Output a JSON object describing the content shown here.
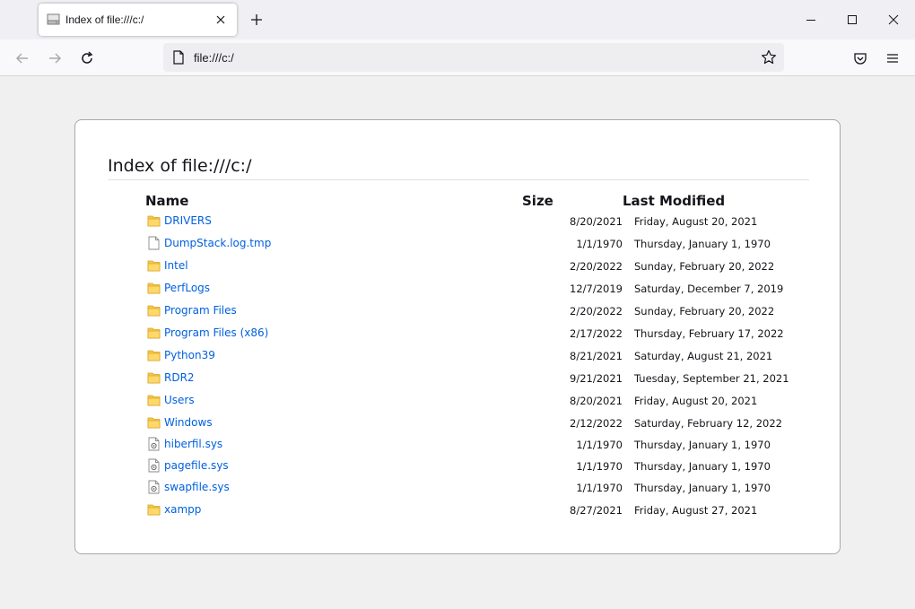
{
  "browser": {
    "tab_title": "Index of file:///c:/",
    "url": "file:///c:/",
    "icons": {
      "favicon": "drive-icon",
      "close": "close-icon",
      "new_tab": "plus-icon",
      "back": "back-arrow-icon",
      "forward": "forward-arrow-icon",
      "reload": "reload-icon",
      "page": "page-icon",
      "bookmark": "star-icon",
      "pocket": "pocket-icon",
      "menu": "hamburger-icon"
    }
  },
  "page": {
    "heading": "Index of file:///c:/",
    "columns": {
      "name": "Name",
      "size": "Size",
      "modified": "Last Modified"
    },
    "entries": [
      {
        "type": "folder",
        "name": "DRIVERS",
        "size": "",
        "date": "8/20/2021",
        "long_date": "Friday, August 20, 2021"
      },
      {
        "type": "file",
        "name": "DumpStack.log.tmp",
        "size": "",
        "date": "1/1/1970",
        "long_date": "Thursday, January 1, 1970"
      },
      {
        "type": "folder",
        "name": "Intel",
        "size": "",
        "date": "2/20/2022",
        "long_date": "Sunday, February 20, 2022"
      },
      {
        "type": "folder",
        "name": "PerfLogs",
        "size": "",
        "date": "12/7/2019",
        "long_date": "Saturday, December 7, 2019"
      },
      {
        "type": "folder",
        "name": "Program Files",
        "size": "",
        "date": "2/20/2022",
        "long_date": "Sunday, February 20, 2022"
      },
      {
        "type": "folder",
        "name": "Program Files (x86)",
        "size": "",
        "date": "2/17/2022",
        "long_date": "Thursday, February 17, 2022"
      },
      {
        "type": "folder",
        "name": "Python39",
        "size": "",
        "date": "8/21/2021",
        "long_date": "Saturday, August 21, 2021"
      },
      {
        "type": "folder",
        "name": "RDR2",
        "size": "",
        "date": "9/21/2021",
        "long_date": "Tuesday, September 21, 2021"
      },
      {
        "type": "folder",
        "name": "Users",
        "size": "",
        "date": "8/20/2021",
        "long_date": "Friday, August 20, 2021"
      },
      {
        "type": "folder",
        "name": "Windows",
        "size": "",
        "date": "2/12/2022",
        "long_date": "Saturday, February 12, 2022"
      },
      {
        "type": "system",
        "name": "hiberfil.sys",
        "size": "",
        "date": "1/1/1970",
        "long_date": "Thursday, January 1, 1970"
      },
      {
        "type": "system",
        "name": "pagefile.sys",
        "size": "",
        "date": "1/1/1970",
        "long_date": "Thursday, January 1, 1970"
      },
      {
        "type": "system",
        "name": "swapfile.sys",
        "size": "",
        "date": "1/1/1970",
        "long_date": "Thursday, January 1, 1970"
      },
      {
        "type": "folder",
        "name": "xampp",
        "size": "",
        "date": "8/27/2021",
        "long_date": "Friday, August 27, 2021"
      }
    ]
  },
  "colors": {
    "link": "#0060df",
    "folder": "#f5c84c",
    "card_border": "#a8a8a8"
  }
}
